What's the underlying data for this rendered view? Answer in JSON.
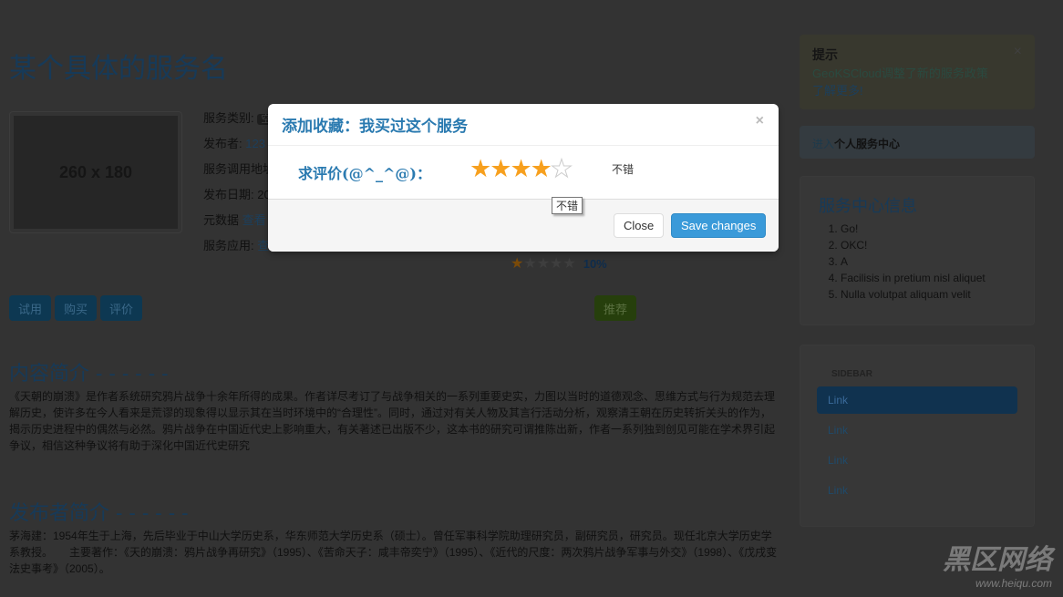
{
  "page": {
    "title": "某个具体的服务名",
    "thumb": "260 x 180",
    "info": [
      {
        "label": "服务类别:",
        "value": "空"
      },
      {
        "label": "发布者:",
        "value": "123"
      },
      {
        "label": "服务调用地址",
        "value": ""
      },
      {
        "label": "发布日期:",
        "value": "20"
      },
      {
        "label": "元数据",
        "value": "查看"
      },
      {
        "label": "服务应用:",
        "value": "查"
      }
    ],
    "rating": {
      "stars": 1,
      "max": 5,
      "percent": "10%"
    },
    "buttons": {
      "try": "试用",
      "buy": "购买",
      "review": "评价",
      "recommend": "推荐"
    },
    "intro_title": "内容简介 - - - - - -",
    "intro": "《天朝的崩溃》是作者系统研究鸦片战争十余年所得的成果。作者详尽考订了与战争相关的一系列重要史实，力图以当时的道德观念、思维方式与行为规范去理解历史，使许多在今人看来是荒谬的现象得以显示其在当时环境中的“合理性”。同时，通过对有关人物及其言行活动分析，观察清王朝在历史转折关头的作为，揭示历史进程中的偶然与必然。鸦片战争在中国近代史上影响重大，有关著述已出版不少，这本书的研究可谓推陈出新，作者一系列独到创见可能在学术界引起争议，相信这种争议将有助于深化中国近代史研究",
    "author_title": "发布者简介 - - - - - -",
    "author": "茅海建：1954年生于上海，先后毕业于中山大学历史系，华东师范大学历史系（硕士）。曾任军事科学院助理研究员，副研究员，研究员。现任北京大学历史学系教授。　　主要著作：《天的崩溃：鸦片战争再研究》（1995）、《苦命天子：咸丰帝奕宁》（1995）、《近代的尺度：两次鸦片战争军事与外交》（1998）、《戊戌变法史事考》（2005）。"
  },
  "sidebar": {
    "alert_title": "提示",
    "alert_text": "GeoKSCloud调整了新的服务政策",
    "alert_link": "了解更多!",
    "center_prefix": "进入",
    "center_bold": "个人服务中心",
    "info_title": "服务中心信息",
    "info_items": [
      "Go!",
      "OKC!",
      "A",
      "Facilisis in pretium nisl aliquet",
      "Nulla volutpat aliquam velit"
    ],
    "nav_header": "SIDEBAR",
    "nav": [
      "Link",
      "Link",
      "Link",
      "Link"
    ]
  },
  "modal": {
    "title": "添加收藏：我买过这个服务",
    "label": "求评价(@^_^@)：",
    "rating": 4,
    "max": 5,
    "hint": "不错",
    "tooltip": "不错",
    "close": "Close",
    "save": "Save changes"
  },
  "watermark": {
    "text": "黑区网络",
    "url": "www.heiqu.com"
  },
  "colors": {
    "accent": "#3a9ad9",
    "star": "#f7a01e",
    "heading": "#2a7ab0"
  }
}
